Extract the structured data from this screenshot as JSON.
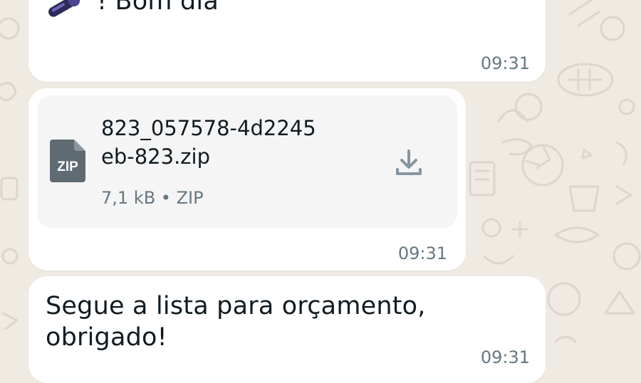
{
  "messages": [
    {
      "text": "! Bom dia",
      "time": "09:31"
    },
    {
      "file": {
        "name_line1": "823_057578-4d2245",
        "name_line2": "eb-823.zip",
        "meta": "7,1 kB • ZIP",
        "icon_label": "ZIP",
        "icon": "zip-file-icon"
      },
      "time": "09:31"
    },
    {
      "text_line1": "Segue a lista para orçamento,",
      "text_line2": "obrigado!",
      "time": "09:31"
    }
  ],
  "colors": {
    "wallpaper": "#efeae2",
    "bubble": "#ffffff",
    "text": "#111b21",
    "muted": "#667781",
    "icon": "#8696a0"
  }
}
